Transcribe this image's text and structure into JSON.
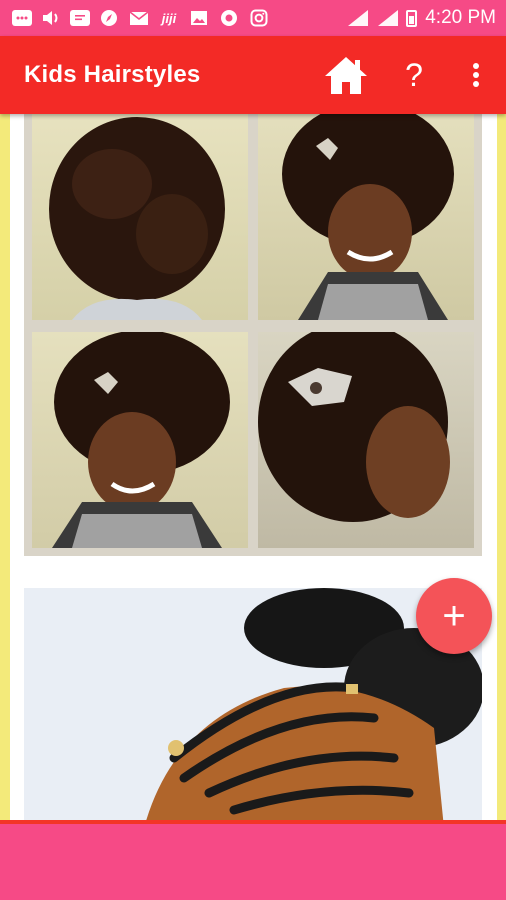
{
  "status_bar": {
    "time": "4:20 PM",
    "notification_icons": [
      "messages-icon",
      "volume-icon",
      "sms-icon",
      "compass-icon",
      "mail-icon",
      "jiji-icon",
      "gallery-icon",
      "app-icon",
      "instagram-icon"
    ],
    "jiji_label": "jiji"
  },
  "app_bar": {
    "title": "Kids Hairstyles",
    "help_label": "?"
  },
  "fab": {
    "label": "+"
  },
  "colors": {
    "status_bar": "#f64a86",
    "app_bar": "#f32a26",
    "fab": "#f45358",
    "side_background": "#f3ea7a"
  }
}
